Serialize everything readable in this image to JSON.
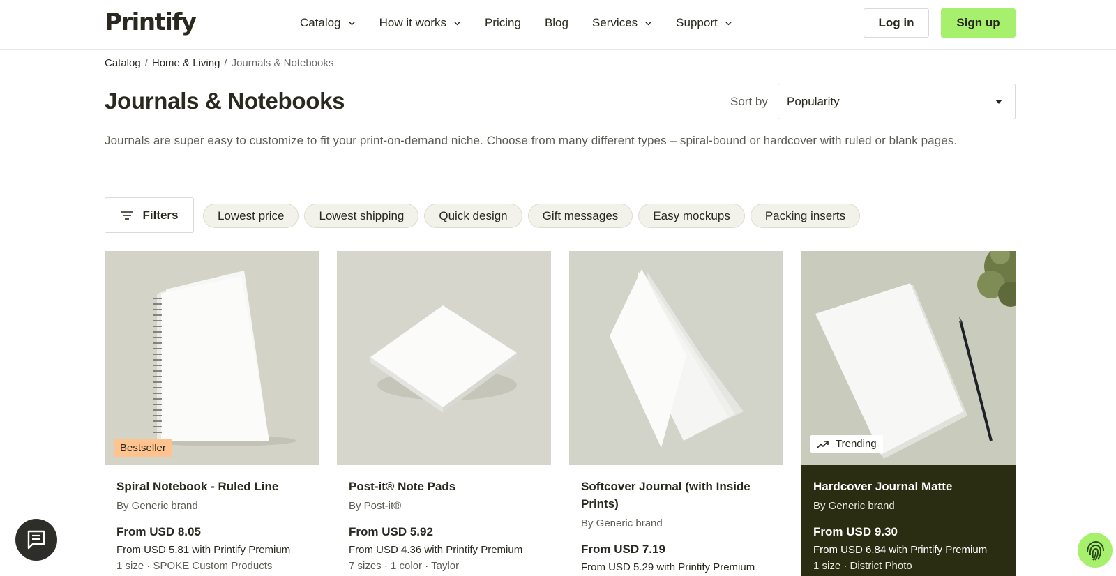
{
  "header": {
    "logo": "Printify",
    "nav": [
      {
        "label": "Catalog",
        "has_dropdown": true
      },
      {
        "label": "How it works",
        "has_dropdown": true
      },
      {
        "label": "Pricing",
        "has_dropdown": false
      },
      {
        "label": "Blog",
        "has_dropdown": false
      },
      {
        "label": "Services",
        "has_dropdown": true
      },
      {
        "label": "Support",
        "has_dropdown": true
      }
    ],
    "login_label": "Log in",
    "signup_label": "Sign up",
    "signup_color": "#a6f06e"
  },
  "breadcrumb": {
    "items": [
      "Catalog",
      "Home & Living"
    ],
    "separator": "/",
    "current": "Journals & Notebooks"
  },
  "page": {
    "title": "Journals & Notebooks",
    "sort_label": "Sort by",
    "sort_value": "Popularity",
    "description": "Journals are super easy to customize to fit your print-on-demand niche. Choose from many different types – spiral-bound or hardcover with ruled or blank pages."
  },
  "filters": {
    "button_label": "Filters",
    "chips": [
      "Lowest price",
      "Lowest shipping",
      "Quick design",
      "Gift messages",
      "Easy mockups",
      "Packing inserts"
    ]
  },
  "products": [
    {
      "name": "Spiral Notebook - Ruled Line",
      "brand": "By Generic brand",
      "price": "From USD 8.05",
      "premium_price": "From USD 5.81 with Printify Premium",
      "meta": "1 size · SPOKE Custom Products",
      "badge": "Bestseller",
      "icon": "spiral-notebook-image"
    },
    {
      "name": "Post-it® Note Pads",
      "brand": "By Post-it®",
      "price": "From USD 5.92",
      "premium_price": "From USD 4.36 with Printify Premium",
      "meta": "7 sizes · 1 color · Taylor",
      "badge": "",
      "icon": "note-pad-image"
    },
    {
      "name": "Softcover Journal (with Inside Prints)",
      "brand": "By Generic brand",
      "price": "From USD 7.19",
      "premium_price": "From USD 5.29 with Printify Premium",
      "meta": "",
      "badge": "",
      "icon": "softcover-journal-image"
    },
    {
      "name": "Hardcover Journal Matte",
      "brand": "By Generic brand",
      "price": "From USD 9.30",
      "premium_price": "From USD 6.84 with Printify Premium",
      "meta": "1 size · District Photo",
      "badge": "Trending",
      "icon": "hardcover-journal-image"
    }
  ],
  "floating": {
    "chat_icon": "chat-icon",
    "fingerprint_icon": "fingerprint-icon"
  }
}
